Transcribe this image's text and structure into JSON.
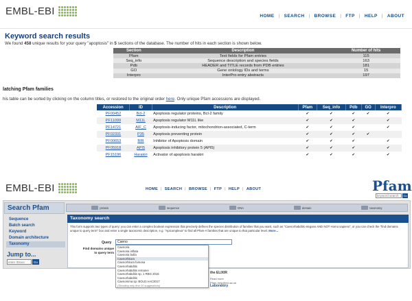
{
  "top": {
    "logo_text": "EMBL-EBI",
    "nav": [
      "HOME",
      "SEARCH",
      "BROWSE",
      "FTP",
      "HELP",
      "ABOUT"
    ],
    "heading": "Keyword search results",
    "summary_prefix": "We found ",
    "summary_count": "458",
    "summary_mid": " unique results for your query \"apoptosis\" in ",
    "summary_sections": "5",
    "summary_suffix": " sections of the database. The number of hits in each section is shown below.",
    "sections_table": {
      "headers": [
        "Section",
        "Description",
        "Number of hits"
      ],
      "rows": [
        [
          "Pfam",
          "Text fields for Pfam entries",
          "115"
        ],
        [
          "Seq_info",
          "Sequence description and species fields",
          "163"
        ],
        [
          "Pdb",
          "HEADER and TITLE records from PDB entries",
          "181"
        ],
        [
          "GO",
          "Gene ontology IDs and terms",
          "15"
        ],
        [
          "Interpro",
          "InterPro entry abstracts",
          "197"
        ]
      ]
    },
    "matching_title": "latching Pfam families",
    "matching_sub_pre": "his table can be sorted by clicking on the column titles, or restored to the original order ",
    "matching_sub_link": "here",
    "matching_sub_post": ". Only unique Pfam accessions are displayed.",
    "families_table": {
      "headers": [
        "Accession",
        "ID",
        "Description",
        "Pfam",
        "Seq_info",
        "Pdb",
        "GO",
        "Interpro"
      ],
      "rows": [
        {
          "acc": "PF00452",
          "id": "Bcl-2",
          "desc": "Apoptosis regulator proteins, Bcl-2 family",
          "pfam": "✔",
          "seq": "✔",
          "pdb": "✔",
          "go": "✔",
          "ipr": "✔"
        },
        {
          "acc": "PF11099",
          "id": "M11L",
          "desc": "Apoptosis regulator M11L like",
          "pfam": "✔",
          "seq": "✔",
          "pdb": "✔",
          "go": "",
          "ipr": "✔"
        },
        {
          "acc": "PF14721",
          "id": "AIF_C",
          "desc": "Apoptosis-inducing factor, mitochondrion-associated, C-term",
          "pfam": "✔",
          "seq": "✔",
          "pdb": "✔",
          "go": "",
          "ipr": "✔"
        },
        {
          "acc": "PF02331",
          "id": "P35",
          "desc": "Apoptosis preventing protein",
          "pfam": "✔",
          "seq": "✔",
          "pdb": "✔",
          "go": "✔",
          "ipr": ""
        },
        {
          "acc": "PF00653",
          "id": "BIR",
          "desc": "Inhibitor of Apoptosis domain",
          "pfam": "✔",
          "seq": "✔",
          "pdb": "✔",
          "go": "",
          "ipr": "✔"
        },
        {
          "acc": "PF05918",
          "id": "API5",
          "desc": "Apoptosis inhibitory protein 5 (API5)",
          "pfam": "✔",
          "seq": "✔",
          "pdb": "✔",
          "go": "",
          "ipr": "✔"
        },
        {
          "acc": "PF15196",
          "id": "Harakiri",
          "desc": "Activator of apoptosis harakiri",
          "pfam": "✔",
          "seq": "✔",
          "pdb": "✔",
          "go": "",
          "ipr": "✔"
        }
      ]
    }
  },
  "bottom": {
    "logo_text": "EMBL-EBI",
    "nav": [
      "HOME",
      "SEARCH",
      "BROWSE",
      "FTP",
      "HELP",
      "ABOUT"
    ],
    "pfam_logo": "Pfam",
    "pfam_search_placeholder": "keyword search",
    "go_label": "Go",
    "search_title": "Search Pfam",
    "toolbar": [
      "protein",
      "sequence",
      "DNA",
      "domain",
      "taxonomy"
    ],
    "menu": [
      "Sequence",
      "Batch search",
      "Keyword",
      "Domain architecture",
      "Taxonomy"
    ],
    "active_menu": "Taxonomy",
    "jump_label": "Jump to...",
    "jump_placeholder": "enter ID/acc",
    "panel_title": "Taxonomy search",
    "panel_desc": "This form supports two types of query: you can enter a complex boolean expression that precisely defines the species distribution of families that you want, such as \"Caenorhabditis elegans AND NOT Homo sapiens\", or you can check the \"find domains unique to query term\" box and enter a single taxonomic description, e.g. \"Apicomplexa\" to find all Pfam-A families that are unique to that particular level.",
    "panel_desc_more": "More...",
    "query_label": "Query",
    "query_value": "Caeno",
    "find_label": "Find domains unique to query term",
    "suggestions": [
      "Caenoria",
      "Caenoria inflata",
      "Caenoria bulla",
      "Caenorhitura",
      "Caenorhitura fumosa",
      "Caenorhabditis",
      "Caenorhabditis remanei",
      "Caenorhabditis sp. 1 RBG 2015",
      "Caenorhabditis",
      "Caenomma sp. BOLD:AAC3017"
    ],
    "suggestions_selected": "Caenorhitura",
    "suggestions_more": "(Showing only first 10 suggestions)",
    "footer_title": "the ELIXIR",
    "footer_line1": "Read more",
    "footer_line2": "Pfam-help@ebi.ac.uk",
    "footer_line3": "Laboratory"
  }
}
